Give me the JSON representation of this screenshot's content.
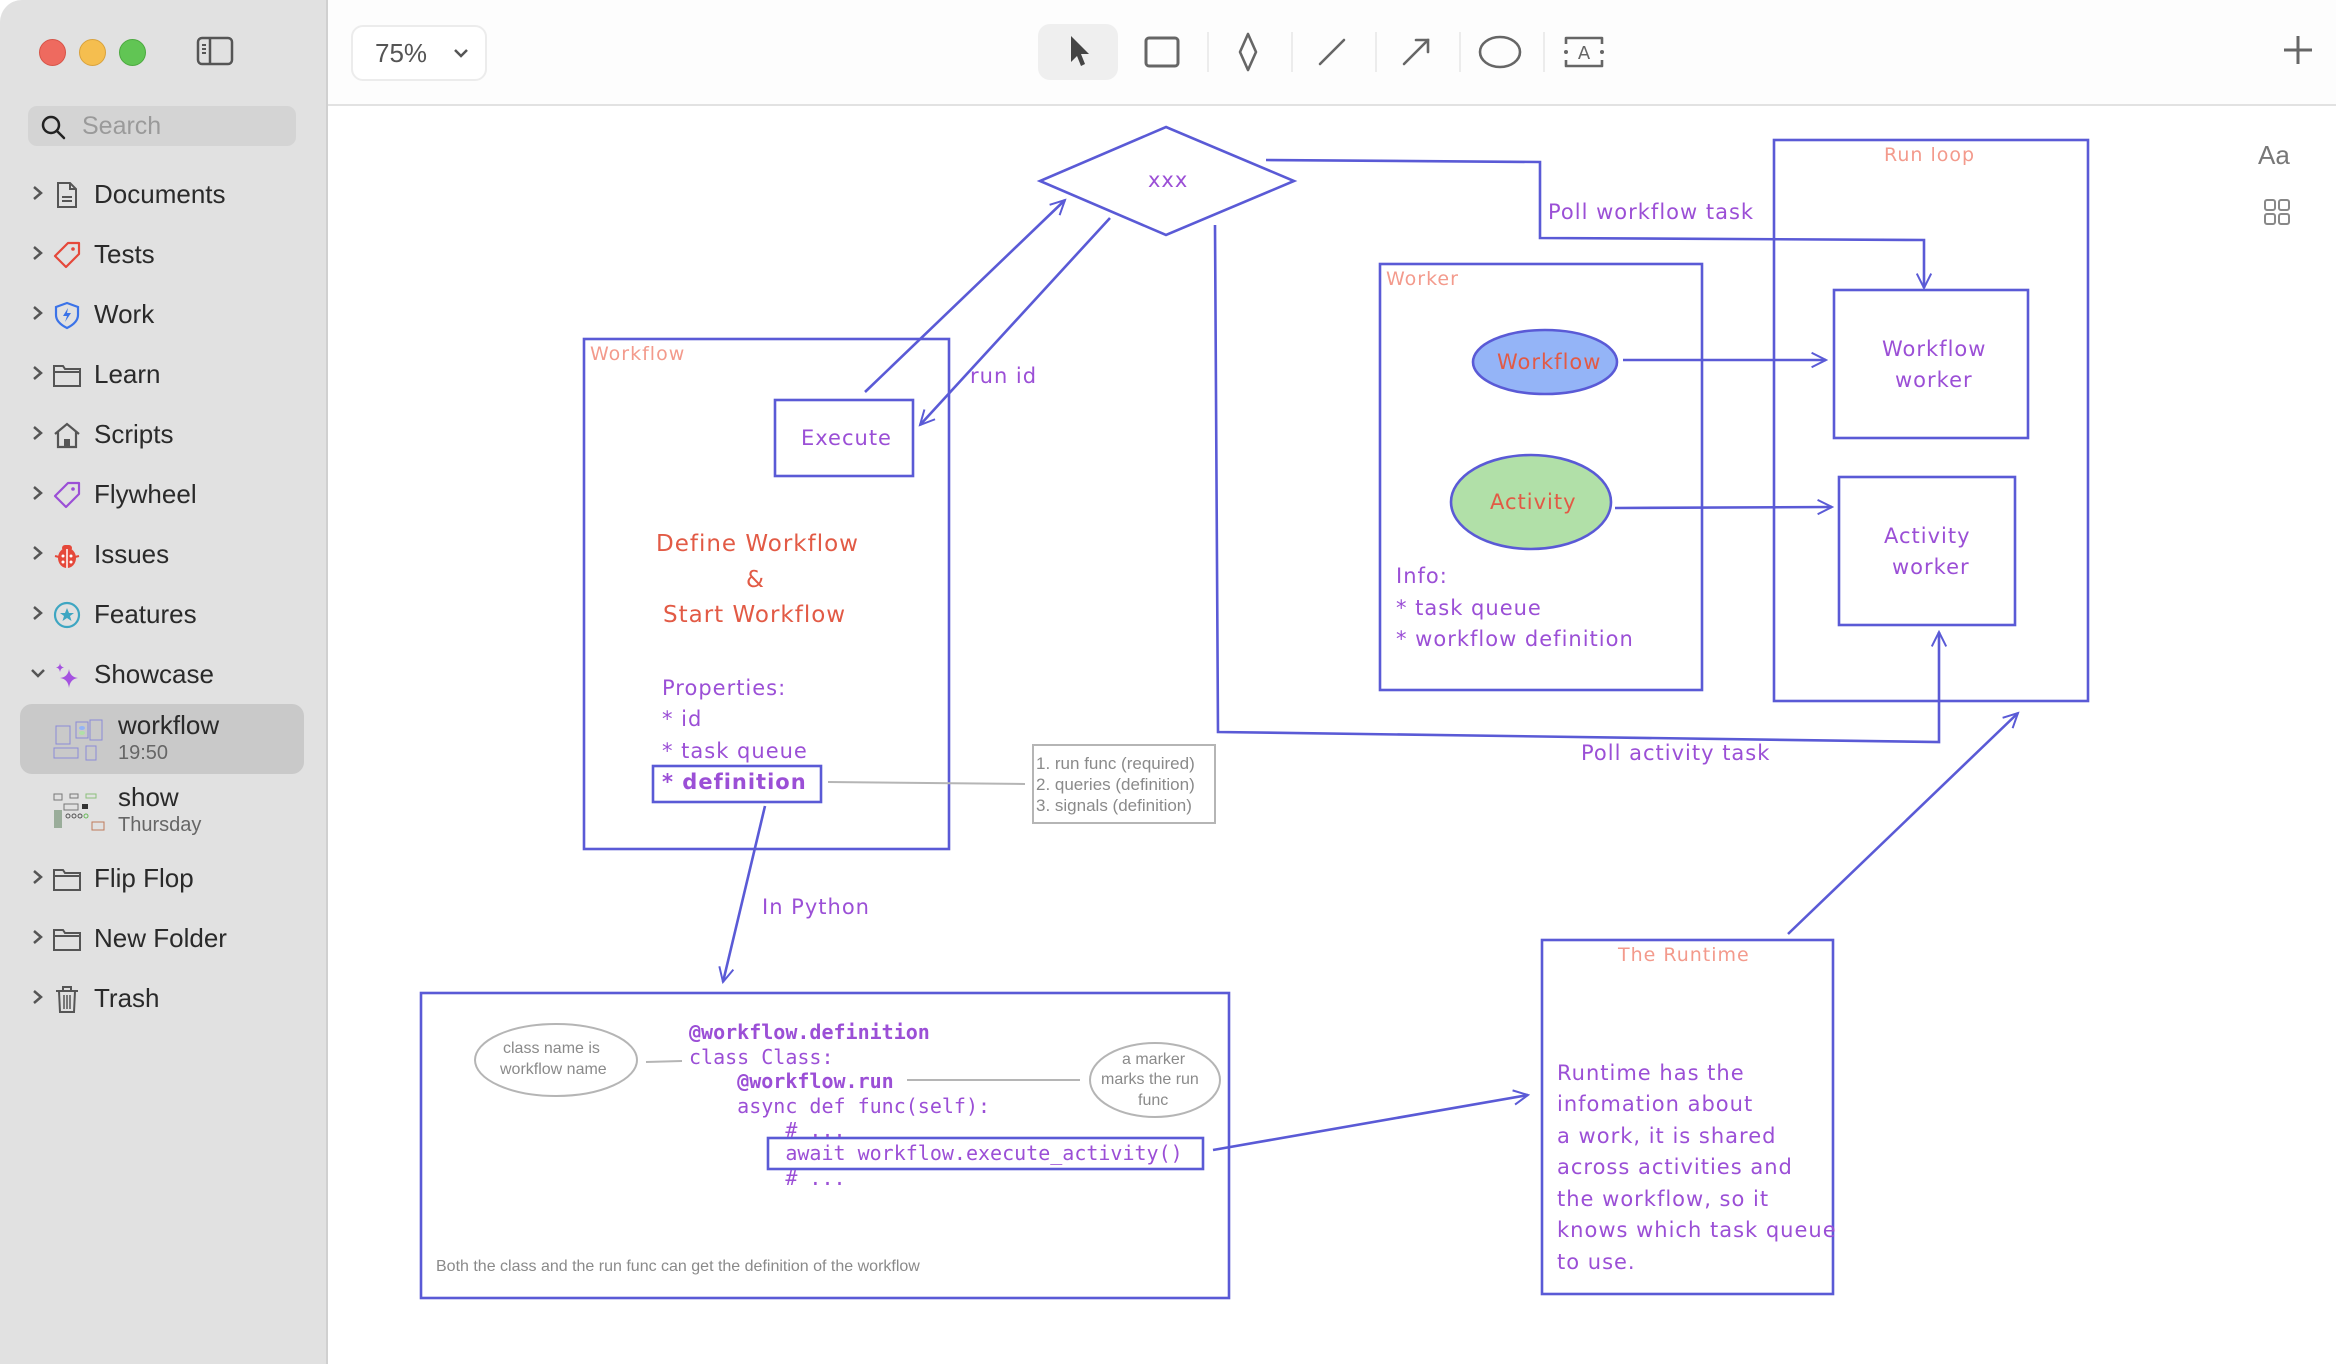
{
  "window": {
    "traffic_lights": [
      "close",
      "minimize",
      "zoom"
    ]
  },
  "sidebar": {
    "search_placeholder": "Search",
    "items": [
      {
        "label": "Documents",
        "icon": "document-icon",
        "expanded": false
      },
      {
        "label": "Tests",
        "icon": "tag-icon",
        "expanded": false
      },
      {
        "label": "Work",
        "icon": "shield-bolt-icon",
        "expanded": false
      },
      {
        "label": "Learn",
        "icon": "folder-icon",
        "expanded": false
      },
      {
        "label": "Scripts",
        "icon": "house-icon",
        "expanded": false
      },
      {
        "label": "Flywheel",
        "icon": "tag-icon",
        "expanded": false
      },
      {
        "label": "Issues",
        "icon": "ladybug-icon",
        "expanded": false
      },
      {
        "label": "Features",
        "icon": "star-circle-icon",
        "expanded": false
      },
      {
        "label": "Showcase",
        "icon": "sparkles-icon",
        "expanded": true
      },
      {
        "label": "Flip Flop",
        "icon": "folder-icon",
        "expanded": false
      },
      {
        "label": "New Folder",
        "icon": "folder-icon",
        "expanded": false
      },
      {
        "label": "Trash",
        "icon": "trash-icon",
        "expanded": false
      }
    ],
    "showcase_docs": [
      {
        "title": "workflow",
        "subtitle": "19:50",
        "selected": true
      },
      {
        "title": "show",
        "subtitle": "Thursday",
        "selected": false
      }
    ]
  },
  "toolbar": {
    "zoom_level": "75%",
    "tools": [
      "select-tool",
      "rectangle-tool",
      "diamond-tool",
      "line-tool",
      "arrow-tool",
      "ellipse-tool",
      "text-tool"
    ],
    "active_tool": "select-tool",
    "font_button": "Aa"
  },
  "colors": {
    "stroke": "#5a5ad6",
    "text_purple": "#9b4fd6",
    "title_salmon": "#f39a8c",
    "text_red": "#e25a45",
    "ellipse_blue": "#94b4f7",
    "ellipse_green": "#b1e0a8",
    "note_grey": "#8a8a8a"
  },
  "diagram": {
    "decision": "xxx",
    "workflow_box": {
      "title": "Workflow",
      "execute": "Execute",
      "heading_lines": [
        "Define Workflow",
        "&",
        "Start Workflow"
      ],
      "properties_title": "Properties:",
      "properties": [
        "* id",
        "* task queue",
        "* definition"
      ]
    },
    "definition_note": [
      "1. run func (required)",
      "2. queries (definition)",
      "3. signals (definition)"
    ],
    "run_id_label": "run id",
    "poll_workflow_label": "Poll workflow task",
    "poll_activity_label": "Poll activity task",
    "in_python_label": "In Python",
    "worker_box": {
      "title": "Worker",
      "workflow_ellipse": "Workflow",
      "activity_ellipse": "Activity",
      "info_title": "Info:",
      "info": [
        "* task queue",
        "* workflow definition"
      ]
    },
    "run_loop_box": {
      "title": "Run loop",
      "workflow_worker": [
        "Workflow",
        "worker"
      ],
      "activity_worker": [
        "Activity",
        "worker"
      ]
    },
    "code_box": {
      "lines": [
        "@workflow.definition",
        "class Class:",
        "    @workflow.run",
        "    async def func(self):",
        "        # ...",
        "        await workflow.execute_activity()",
        "        # ..."
      ],
      "class_note": [
        "class name is",
        "workflow name"
      ],
      "marker_note": [
        "a marker",
        "marks the run",
        "func"
      ],
      "footer": "Both the class and the run func can get the definition of the workflow"
    },
    "runtime_box": {
      "title": "The Runtime",
      "body": [
        "Runtime has the",
        "infomation about",
        "a work, it is shared",
        "across activities and",
        "the workflow, so it",
        "knows which task queue",
        "to use."
      ]
    }
  }
}
